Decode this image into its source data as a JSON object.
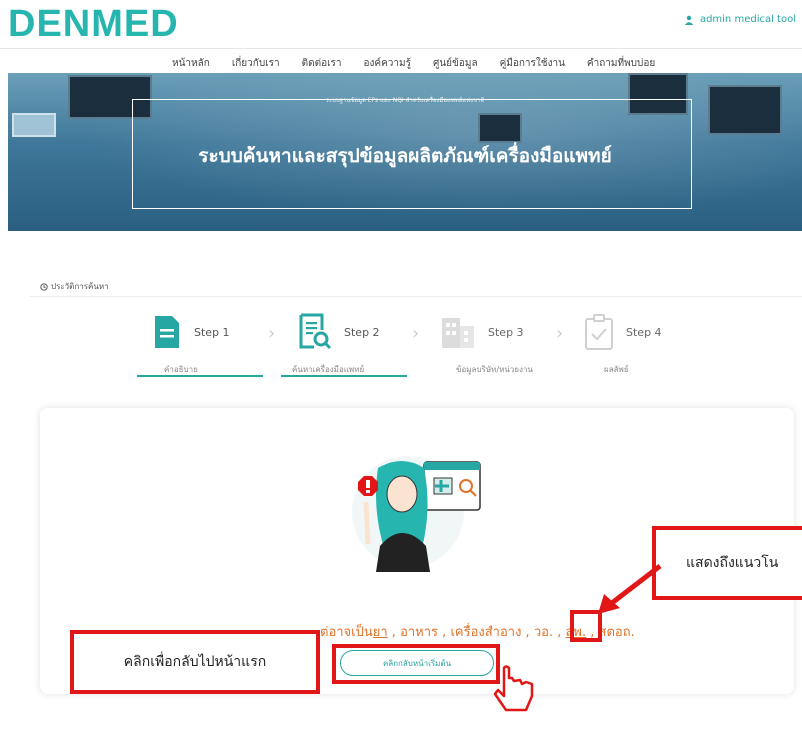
{
  "header": {
    "logo": "DENMED",
    "user": "admin medical tool"
  },
  "nav": [
    "หน้าหลัก",
    "เกี่ยวกับเรา",
    "ติดต่อเรา",
    "องค์ความรู้",
    "ศูนย์ข้อมูล",
    "คู่มือการใช้งาน",
    "คำถามที่พบบ่อย"
  ],
  "hero": {
    "subtitle": "ระบบฐานข้อมูล EPs และ NQI สำหรับเครื่องมือแพทย์แห่งชาติ",
    "title": "ระบบค้นหาและสรุปข้อมูลผลิตภัณฑ์เครื่องมือแพทย์"
  },
  "history": "ประวัติการค้นหา",
  "steps": [
    {
      "label": "Step 1",
      "sub": "คำอธิบาย"
    },
    {
      "label": "Step 2",
      "sub": "ค้นหาเครื่องมือแพทย์"
    },
    {
      "label": "Step 3",
      "sub": "ข้อมูลบริษัท/หน่วยงาน"
    },
    {
      "label": "Step 4",
      "sub": "ผลลัพธ์"
    }
  ],
  "message": {
    "prefix": "ต่อาจเป็น",
    "items": [
      "ยา",
      "อาหาร",
      "เครื่องสำอาง",
      "วอ.",
      "สพ.",
      "สตอถ."
    ]
  },
  "button": "คลิกกลับหน้าเริ่มต้น",
  "annotations": {
    "left": "คลิกเพื่อกลับไปหน้าแรก",
    "right": "แสดงถึงแนวโน"
  },
  "colors": {
    "brand": "#27b5b0",
    "accent": "#e0722a",
    "annotation": "#e11616"
  }
}
